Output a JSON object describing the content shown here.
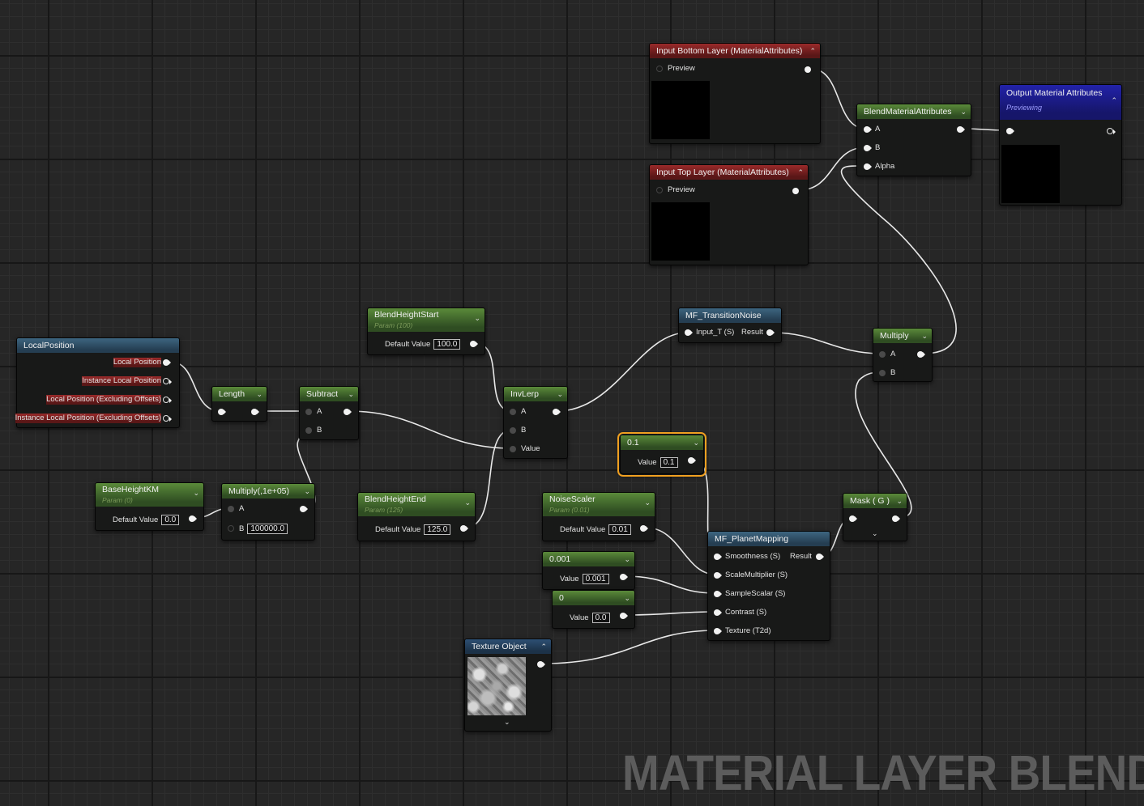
{
  "nodes": {
    "input_bottom": {
      "title": "Input Bottom Layer (MaterialAttributes)",
      "pin": "Preview"
    },
    "input_top": {
      "title": "Input Top Layer (MaterialAttributes)",
      "pin": "Preview"
    },
    "blend": {
      "title": "BlendMaterialAttributes",
      "pins": [
        "A",
        "B",
        "Alpha"
      ]
    },
    "output": {
      "title": "Output Material Attributes",
      "status": "Previewing"
    },
    "local_position": {
      "title": "LocalPosition",
      "pins": [
        "Local Position",
        "Instance Local Position",
        "Local Position (Excluding Offsets)",
        "Instance Local Position (Excluding Offsets)"
      ]
    },
    "length": {
      "title": "Length"
    },
    "subtract": {
      "title": "Subtract",
      "pins": [
        "A",
        "B"
      ]
    },
    "blend_height_start": {
      "title": "BlendHeightStart",
      "sub": "Param (100)",
      "label": "Default Value",
      "value": "100.0"
    },
    "invlerp": {
      "title": "InvLerp",
      "pins": [
        "A",
        "B",
        "Value"
      ]
    },
    "transition_noise": {
      "title": "MF_TransitionNoise",
      "input": "Input_T (S)",
      "output": "Result"
    },
    "multiply": {
      "title": "Multiply",
      "pins": [
        "A",
        "B"
      ]
    },
    "base_height": {
      "title": "BaseHeightKM",
      "sub": "Param (0)",
      "label": "Default Value",
      "value": "0.0"
    },
    "multiply_const": {
      "title": "Multiply(,1e+05)",
      "pin_a": "A",
      "pin_b": "B",
      "value_b": "100000.0"
    },
    "blend_height_end": {
      "title": "BlendHeightEnd",
      "sub": "Param (125)",
      "label": "Default Value",
      "value": "125.0"
    },
    "const_01": {
      "title": "0.1",
      "label": "Value",
      "value": "0.1"
    },
    "noise_scaler": {
      "title": "NoiseScaler",
      "sub": "Param (0.01)",
      "label": "Default Value",
      "value": "0.01"
    },
    "const_0001": {
      "title": "0.001",
      "label": "Value",
      "value": "0.001"
    },
    "const_0": {
      "title": "0",
      "label": "Value",
      "value": "0.0"
    },
    "mask": {
      "title": "Mask ( G )"
    },
    "planet_mapping": {
      "title": "MF_PlanetMapping",
      "inputs": [
        "Smoothness (S)",
        "ScaleMultiplier (S)",
        "SampleScalar (S)",
        "Contrast (S)",
        "Texture (T2d)"
      ],
      "output": "Result"
    },
    "texture_object": {
      "title": "Texture Object"
    }
  },
  "watermark": "MATERIAL LAYER BLEND",
  "colors": {
    "param_header": "#4f7d33",
    "function_header": "#3d6580",
    "input_header": "#9a2a2a",
    "texture_header": "#2d4f73",
    "output_header": "#2222a8",
    "selection": "#f0a020",
    "wire": "#e8e8e8"
  }
}
